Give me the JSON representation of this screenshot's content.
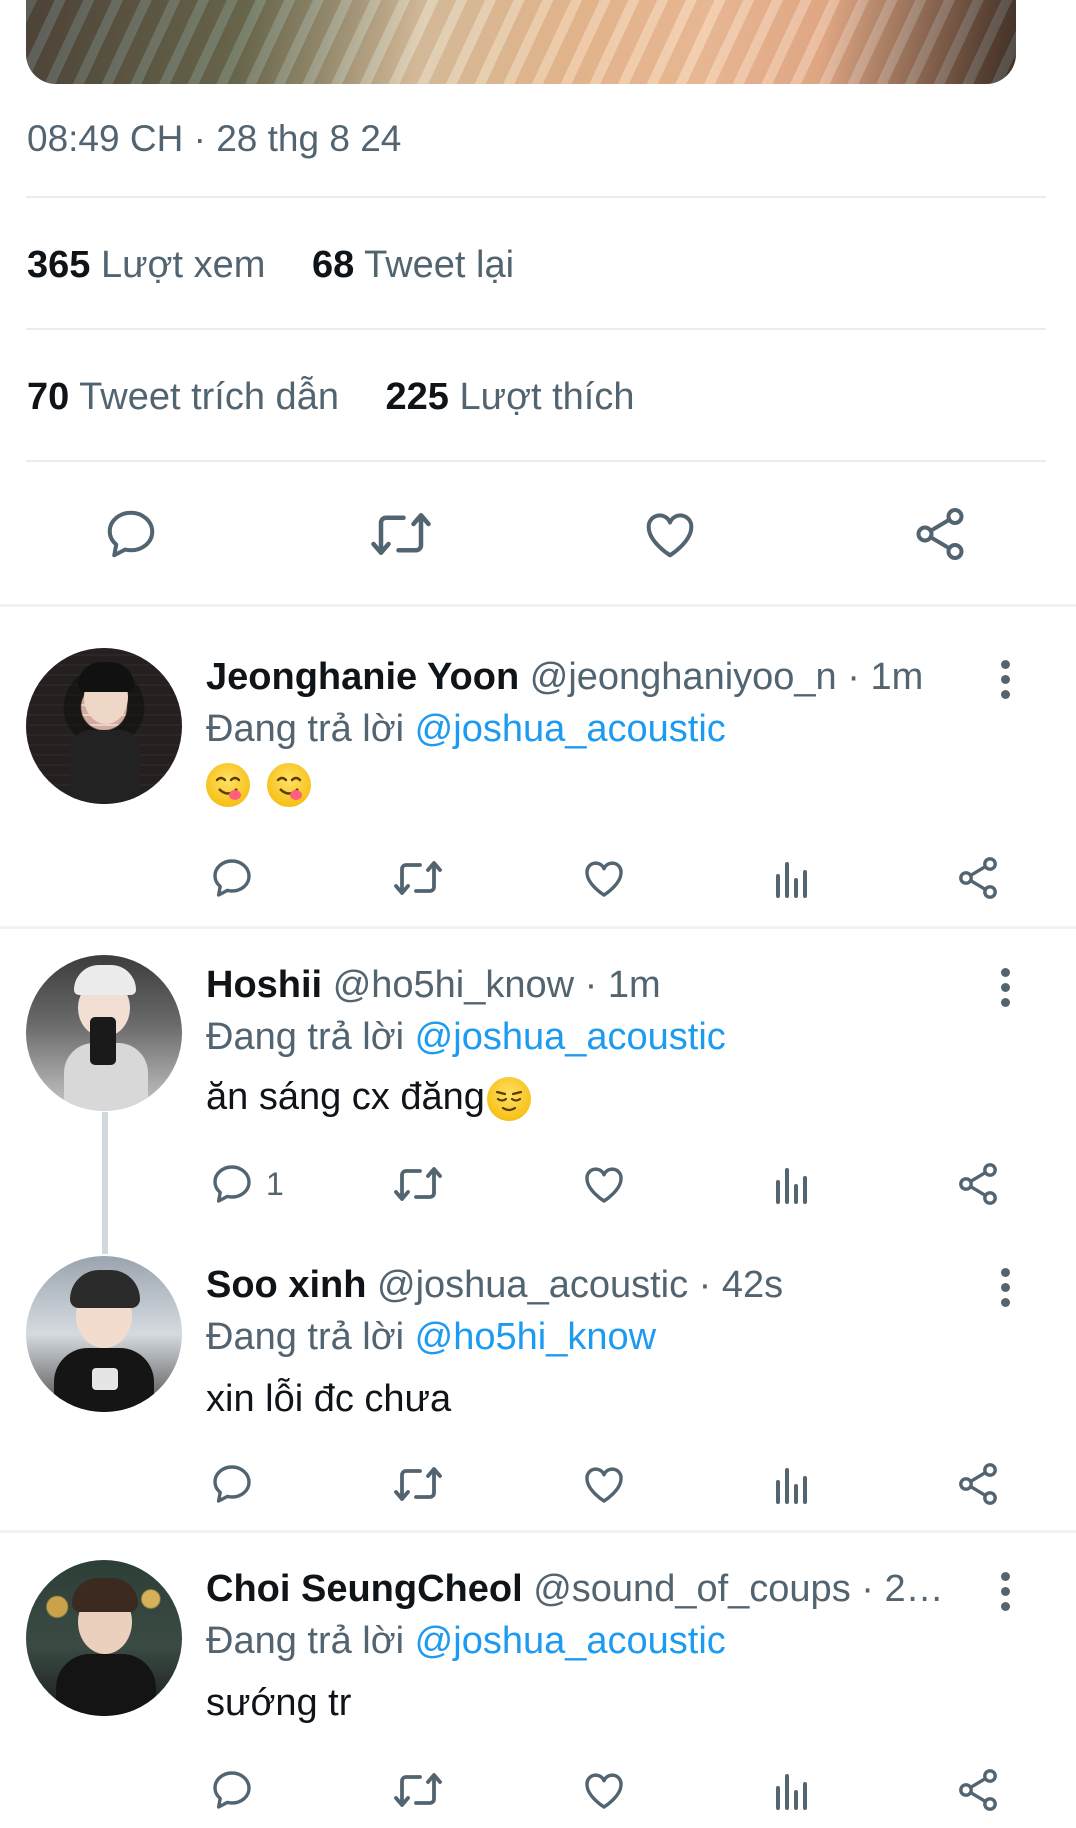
{
  "tweet": {
    "timestamp": "08:49 CH · 28 thg 8 24",
    "stats": {
      "views_count": "365",
      "views_label": "Lượt xem",
      "retweets_count": "68",
      "retweets_label": "Tweet lại",
      "quotes_count": "70",
      "quotes_label": "Tweet trích dẫn",
      "likes_count": "225",
      "likes_label": "Lượt thích"
    }
  },
  "replying_label": "Đang trả lời",
  "replies": [
    {
      "name": "Jeonghanie Yoon",
      "handle": "@jeonghaniyoo_n",
      "time": "· 1m",
      "mention": "@joshua_acoustic",
      "text": "",
      "emojis": [
        "yum-face-emoji",
        "yum-face-emoji"
      ],
      "reply_count": ""
    },
    {
      "name": "Hoshii",
      "handle": "@ho5hi_know",
      "time": "· 1m",
      "mention": "@joshua_acoustic",
      "text": "ăn sáng cx đăng",
      "emojis": [
        "relieved-face-emoji"
      ],
      "reply_count": "1"
    },
    {
      "name": "Soo xinh",
      "handle": "@joshua_acoustic",
      "time": "· 42s",
      "mention": "@ho5hi_know",
      "text": "xin lỗi đc chưa",
      "emojis": [],
      "reply_count": ""
    },
    {
      "name": "Choi SeungCheol",
      "handle": "@sound_of_coups",
      "time": "· 2…",
      "mention": "@joshua_acoustic",
      "text": "sướng tr",
      "emojis": [],
      "reply_count": ""
    }
  ],
  "colors": {
    "accent": "#1d9bf0",
    "secondary_text": "#536471",
    "primary_text": "#0f1419"
  }
}
